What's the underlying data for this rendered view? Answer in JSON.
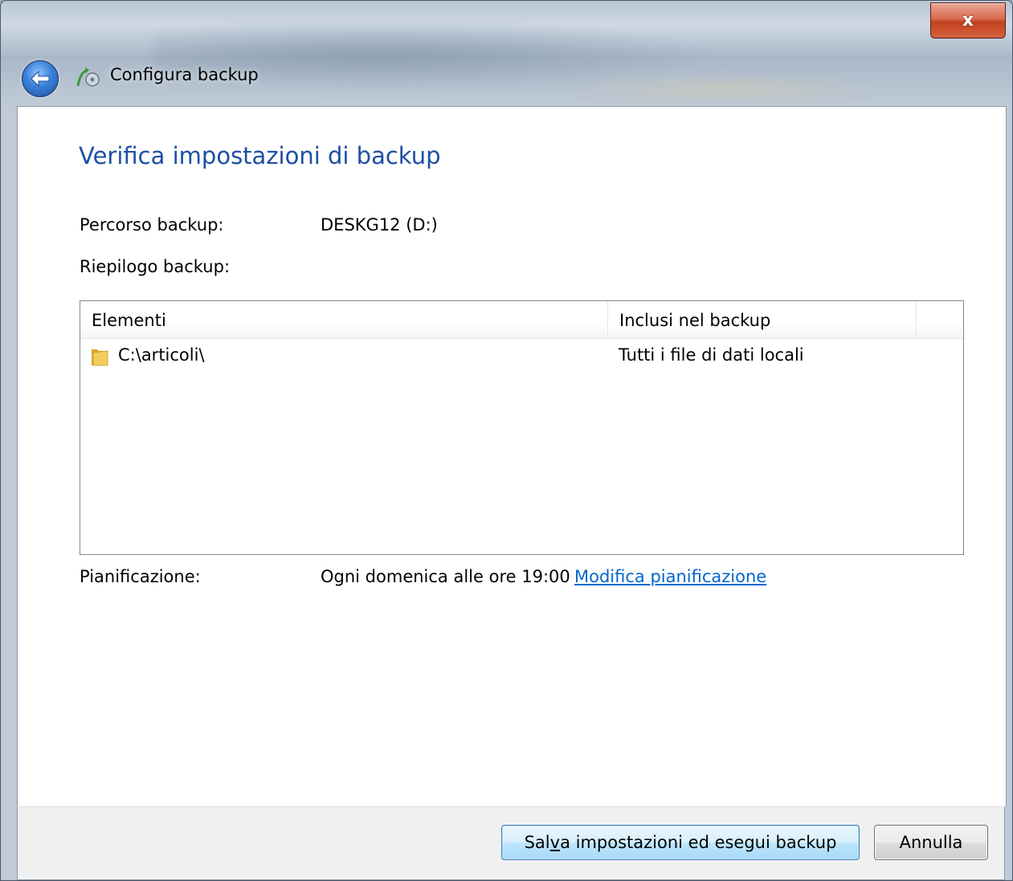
{
  "window": {
    "title": "Configura backup",
    "close_glyph": "x"
  },
  "heading": "Verifica impostazioni di backup",
  "fields": {
    "location_label": "Percorso backup:",
    "location_value": "DESKG12 (D:)",
    "summary_label": "Riepilogo backup:",
    "schedule_label": "Pianificazione:",
    "schedule_value": "Ogni domenica alle ore 19:00",
    "change_schedule_link": "Modifica pianificazione"
  },
  "listview": {
    "columns": [
      "Elementi",
      "Inclusi nel backup"
    ],
    "rows": [
      {
        "item": "C:\\articoli\\",
        "included": "Tutti i file di dati locali",
        "icon": "folder-icon"
      }
    ]
  },
  "buttons": {
    "save_run_prefix": "Sal",
    "save_run_mnemonic": "v",
    "save_run_suffix": "a impostazioni ed esegui backup",
    "cancel": "Annulla"
  },
  "colors": {
    "heading": "#1e4fa3",
    "link": "#0066cc",
    "close_button": "#c2401f"
  }
}
